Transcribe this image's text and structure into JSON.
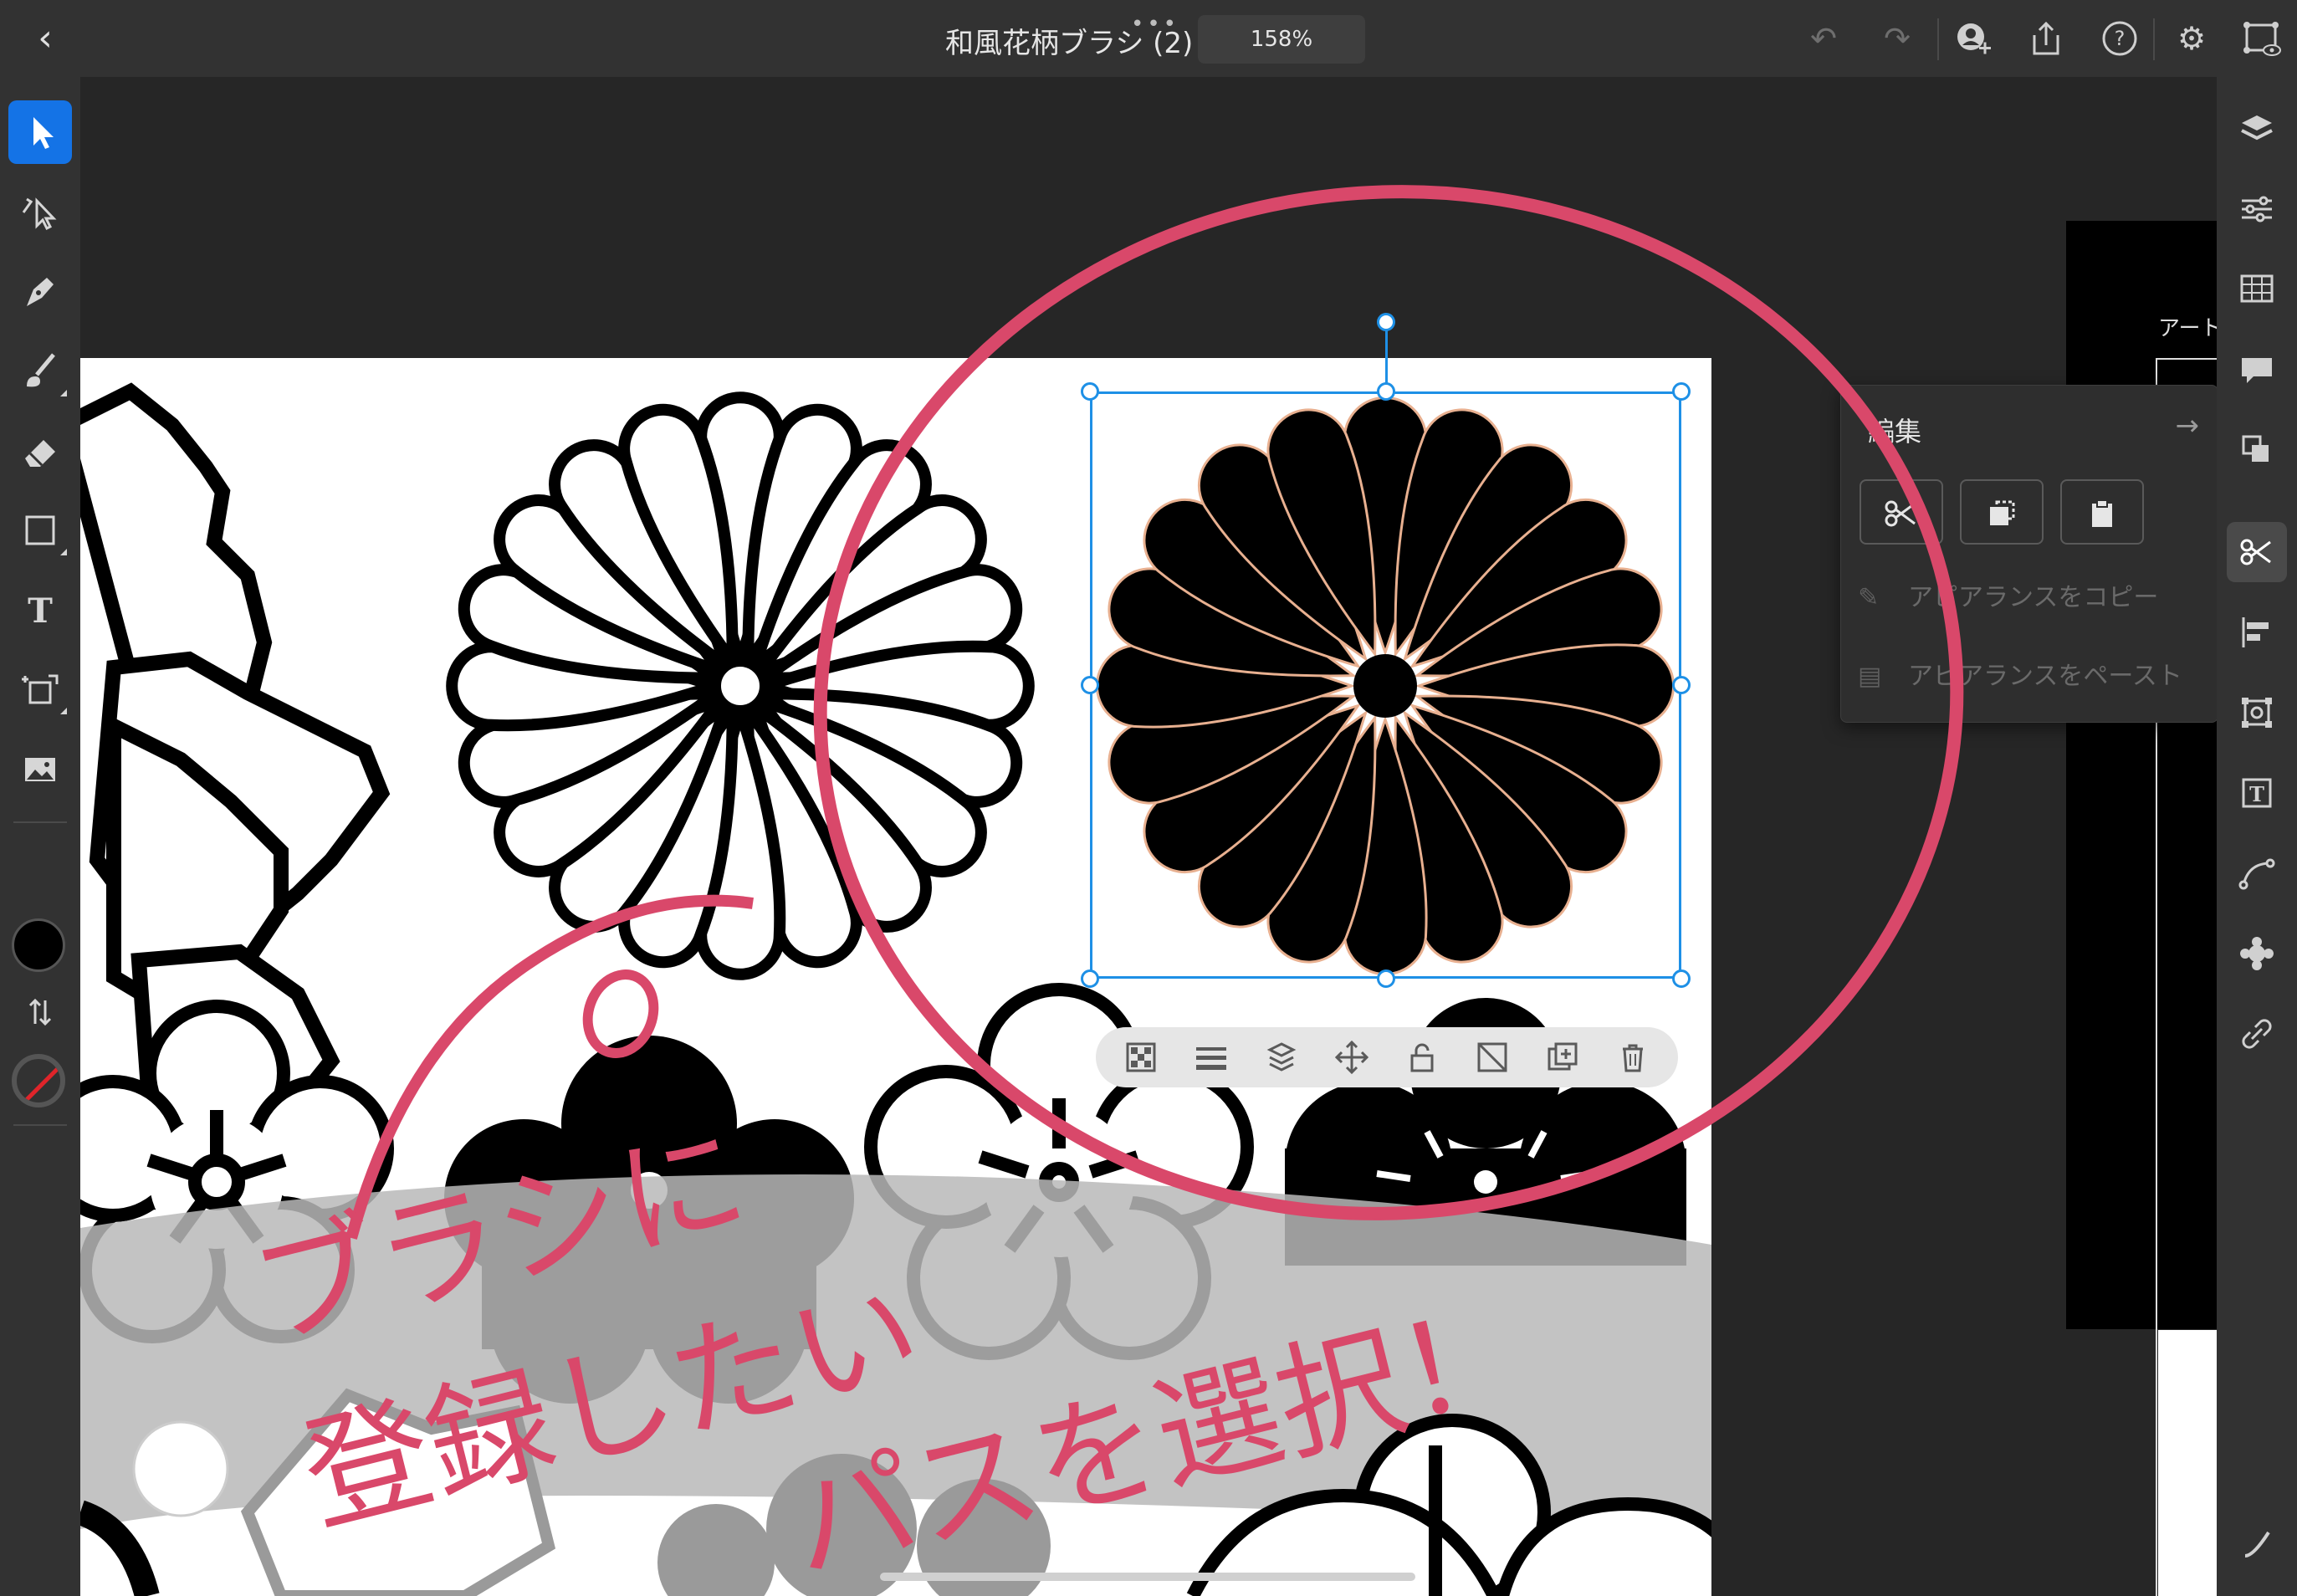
{
  "topbar": {
    "title": "和風花柄ブラシ (2)",
    "zoom": "158%"
  },
  "edit_panel": {
    "title": "編集",
    "copy_appearance": "アピアランスをコピー",
    "paste_appearance": "アピアランスをペースト"
  },
  "right_panel": {
    "label": "アート"
  },
  "annotation": {
    "line1": "ブラシに",
    "line2": "登録したい",
    "line3": "パスを選択！",
    "color": "#d9486a"
  },
  "colors": {
    "accent": "#1473e6",
    "selection": "#1e90e6",
    "fill": "#000000"
  },
  "icons": {
    "left_tools": [
      "selection-icon",
      "direct-selection-icon",
      "pen-icon",
      "brush-icon",
      "eraser-icon",
      "rectangle-icon",
      "text-icon",
      "transform-icon",
      "image-icon"
    ],
    "right_tools": [
      "layers-icon",
      "properties-icon",
      "grid-icon",
      "comments-icon",
      "arrange-icon",
      "edit-icon",
      "align-icon",
      "crop-icon",
      "type-icon",
      "path-icon",
      "effects-icon",
      "link-icon"
    ],
    "context_bar": [
      "transparency-icon",
      "stroke-icon",
      "arrange-icon",
      "move-icon",
      "lock-icon",
      "mask-icon",
      "duplicate-icon",
      "delete-icon"
    ]
  }
}
